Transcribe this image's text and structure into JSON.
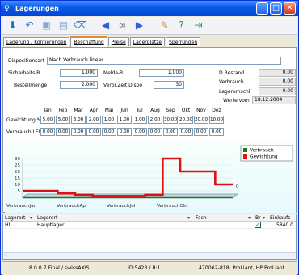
{
  "window": {
    "title": "Lagerungen"
  },
  "tabs": [
    {
      "label": "Lagerung / Kontierungen"
    },
    {
      "label": "Beschaffung"
    },
    {
      "label": "Preise"
    },
    {
      "label": "Lagerplätze"
    },
    {
      "label": "Sperrungen"
    }
  ],
  "form": {
    "dispositionsart_label": "Dispositionsart",
    "dispositionsart_value": "Nach Verbrauch linear",
    "sicherheit_label": "Sicherheits-B.",
    "sicherheit_value": "1.000",
    "melde_label": "Melde-B.",
    "melde_value": "1.000",
    "bestellmenge_label": "Bestellmenge",
    "bestellmenge_value": "2.000",
    "verbrzeit_label": "Verbr.Zeit Dispo",
    "verbrzeit_value": "30",
    "dbestand_label": "D.Bestand",
    "dbestand_value": "0.00",
    "verbrauch_label": "Verbrauch",
    "verbrauch_value": "0.00",
    "lagerumschl_label": "Lagerumschl.",
    "lagerumschl_value": "0.00",
    "wertevom_label": "Werte vom",
    "wertevom_value": "18.12.2004"
  },
  "months": {
    "headers": [
      "Jan",
      "Feb",
      "Mar",
      "Apr",
      "Mai",
      "Jun",
      "Jul",
      "Aug",
      "Sep",
      "Okt",
      "Nov",
      "Dez"
    ],
    "gewichtung_label": "Gewichtung %",
    "gewichtung": [
      "5.00",
      "5.00",
      "3.00",
      "2.00",
      "1.00",
      "1.00",
      "1.00",
      "2.00",
      "30.00",
      "20.00",
      "20.00",
      "10.00"
    ],
    "verbrauch_label": "Verbrauch LEH",
    "verbrauch": [
      "0.00",
      "0.00",
      "0.00",
      "0.00",
      "0.00",
      "0.00",
      "0.00",
      "0.00",
      "0.00",
      "0.00",
      "0.00",
      "0.00"
    ]
  },
  "chart_data": {
    "type": "line",
    "categories": [
      "Jan",
      "Feb",
      "Mar",
      "Apr",
      "Mai",
      "Jun",
      "Jul",
      "Aug",
      "Sep",
      "Okt",
      "Nov",
      "Dez"
    ],
    "xtick_labels": [
      "VerbrauchJan",
      "VerbrauchApr",
      "VerbrauchJul",
      "VerbrauchOkt"
    ],
    "yticks": [
      "30",
      "25",
      "20",
      "15",
      "10",
      "5"
    ],
    "ylim": [
      0,
      30
    ],
    "right_label": "0",
    "series": [
      {
        "name": "Verbrauch",
        "values": [
          0,
          0,
          0,
          0,
          0,
          0,
          0,
          0,
          0,
          0,
          0,
          0
        ],
        "color": "#1a7a1a"
      },
      {
        "name": "Gewichtung",
        "values": [
          5,
          5,
          3,
          2,
          1,
          1,
          1,
          2,
          30,
          20,
          20,
          10
        ],
        "color": "#dd1111"
      }
    ],
    "legend_position": "top-right"
  },
  "grid": {
    "headers": [
      "Lagerort",
      "Lagerort",
      "Fach",
      "Br",
      "Einkaufs"
    ],
    "rows": [
      {
        "lagerort": "HL",
        "name": "Hauptlager",
        "checked": "✓",
        "einkauf": "5840.0"
      }
    ]
  },
  "status": {
    "version": "8.0.0.7 Final / swissAXIS",
    "id": "ID:5423 / R:1",
    "machine": "470062-818, ProLiant, HP ProLiant"
  }
}
